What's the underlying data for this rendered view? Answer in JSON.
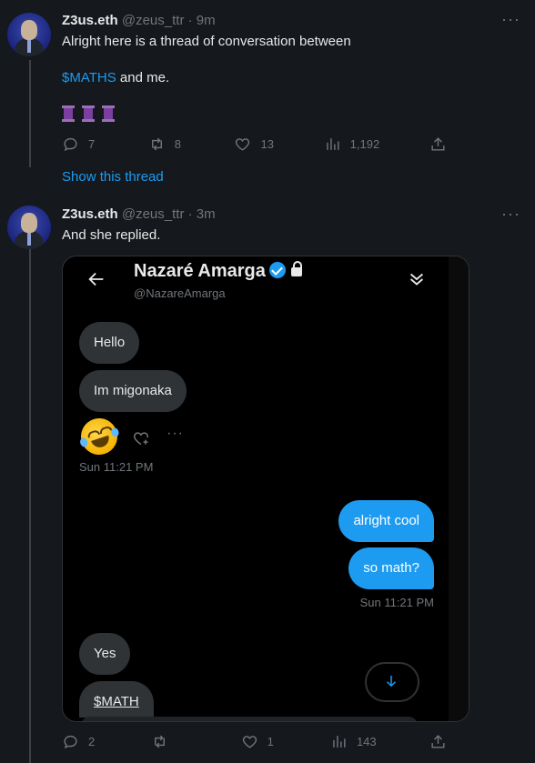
{
  "tweet1": {
    "display_name": "Z3us.eth",
    "handle": "@zeus_ttr",
    "time": "9m",
    "text_line1": "Alright here is a thread of conversation between",
    "cashtag": "$MATHS",
    "text_after_cashtag": "and me.",
    "emoji_count": 3,
    "replies": "7",
    "retweets": "8",
    "likes": "13",
    "views": "1,192"
  },
  "show_thread_label": "Show this thread",
  "tweet2": {
    "display_name": "Z3us.eth",
    "handle": "@zeus_ttr",
    "time": "3m",
    "text": "And she replied.",
    "replies": "2",
    "retweets": "",
    "likes": "1",
    "views": "143"
  },
  "dm": {
    "contact_name": "Nazaré Amarga",
    "contact_handle": "@NazareAmarga",
    "messages_in_1": [
      "Hello",
      "Im migonaka"
    ],
    "time_in_1": "Sun 11:21 PM",
    "messages_out": [
      "alright cool",
      "so math?"
    ],
    "time_out": "Sun 11:21 PM",
    "messages_in_2": [
      "Yes",
      "$MATH"
    ],
    "reaction_icon": "rolling-on-floor-laughing-emoji"
  },
  "colors": {
    "background": "#15181c",
    "accent": "#1d9bf0",
    "muted": "#71767b",
    "bubble_in": "#2f3336"
  }
}
